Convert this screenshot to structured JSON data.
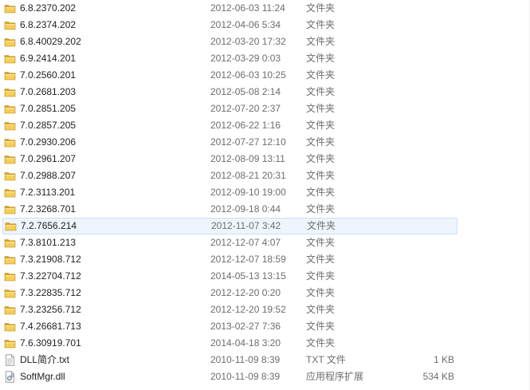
{
  "files": [
    {
      "name": "6.8.2370.202",
      "date": "2012-06-03 11:24",
      "type": "文件夹",
      "size": "",
      "icon": "folder-icon"
    },
    {
      "name": "6.8.2374.202",
      "date": "2012-04-06 5:34",
      "type": "文件夹",
      "size": "",
      "icon": "folder-icon"
    },
    {
      "name": "6.8.40029.202",
      "date": "2012-03-20 17:32",
      "type": "文件夹",
      "size": "",
      "icon": "folder-icon"
    },
    {
      "name": "6.9.2414.201",
      "date": "2012-03-29 0:03",
      "type": "文件夹",
      "size": "",
      "icon": "folder-icon"
    },
    {
      "name": "7.0.2560.201",
      "date": "2012-06-03 10:25",
      "type": "文件夹",
      "size": "",
      "icon": "folder-icon"
    },
    {
      "name": "7.0.2681.203",
      "date": "2012-05-08 2:14",
      "type": "文件夹",
      "size": "",
      "icon": "folder-icon"
    },
    {
      "name": "7.0.2851.205",
      "date": "2012-07-20 2:37",
      "type": "文件夹",
      "size": "",
      "icon": "folder-icon"
    },
    {
      "name": "7.0.2857.205",
      "date": "2012-06-22 1:16",
      "type": "文件夹",
      "size": "",
      "icon": "folder-icon"
    },
    {
      "name": "7.0.2930.206",
      "date": "2012-07-27 12:10",
      "type": "文件夹",
      "size": "",
      "icon": "folder-icon"
    },
    {
      "name": "7.0.2961.207",
      "date": "2012-08-09 13:11",
      "type": "文件夹",
      "size": "",
      "icon": "folder-icon"
    },
    {
      "name": "7.0.2988.207",
      "date": "2012-08-21 20:31",
      "type": "文件夹",
      "size": "",
      "icon": "folder-icon"
    },
    {
      "name": "7.2.3113.201",
      "date": "2012-09-10 19:00",
      "type": "文件夹",
      "size": "",
      "icon": "folder-icon"
    },
    {
      "name": "7.2.3268.701",
      "date": "2012-09-18 0:44",
      "type": "文件夹",
      "size": "",
      "icon": "folder-icon"
    },
    {
      "name": "7.2.7656.214",
      "date": "2012-11-07 3:42",
      "type": "文件夹",
      "size": "",
      "icon": "folder-icon",
      "hover": true
    },
    {
      "name": "7.3.8101.213",
      "date": "2012-12-07 4:07",
      "type": "文件夹",
      "size": "",
      "icon": "folder-icon"
    },
    {
      "name": "7.3.21908.712",
      "date": "2012-12-07 18:59",
      "type": "文件夹",
      "size": "",
      "icon": "folder-icon"
    },
    {
      "name": "7.3.22704.712",
      "date": "2014-05-13 13:15",
      "type": "文件夹",
      "size": "",
      "icon": "folder-icon"
    },
    {
      "name": "7.3.22835.712",
      "date": "2012-12-20 0:20",
      "type": "文件夹",
      "size": "",
      "icon": "folder-icon"
    },
    {
      "name": "7.3.23256.712",
      "date": "2012-12-20 19:52",
      "type": "文件夹",
      "size": "",
      "icon": "folder-icon"
    },
    {
      "name": "7.4.26681.713",
      "date": "2013-02-27 7:36",
      "type": "文件夹",
      "size": "",
      "icon": "folder-icon"
    },
    {
      "name": "7.6.30919.701",
      "date": "2014-04-18 3:20",
      "type": "文件夹",
      "size": "",
      "icon": "folder-icon"
    },
    {
      "name": "DLL简介.txt",
      "date": "2010-11-09 8:39",
      "type": "TXT 文件",
      "size": "1 KB",
      "icon": "text-file-icon"
    },
    {
      "name": "SoftMgr.dll",
      "date": "2010-11-09 8:39",
      "type": "应用程序扩展",
      "size": "534 KB",
      "icon": "dll-file-icon"
    }
  ]
}
